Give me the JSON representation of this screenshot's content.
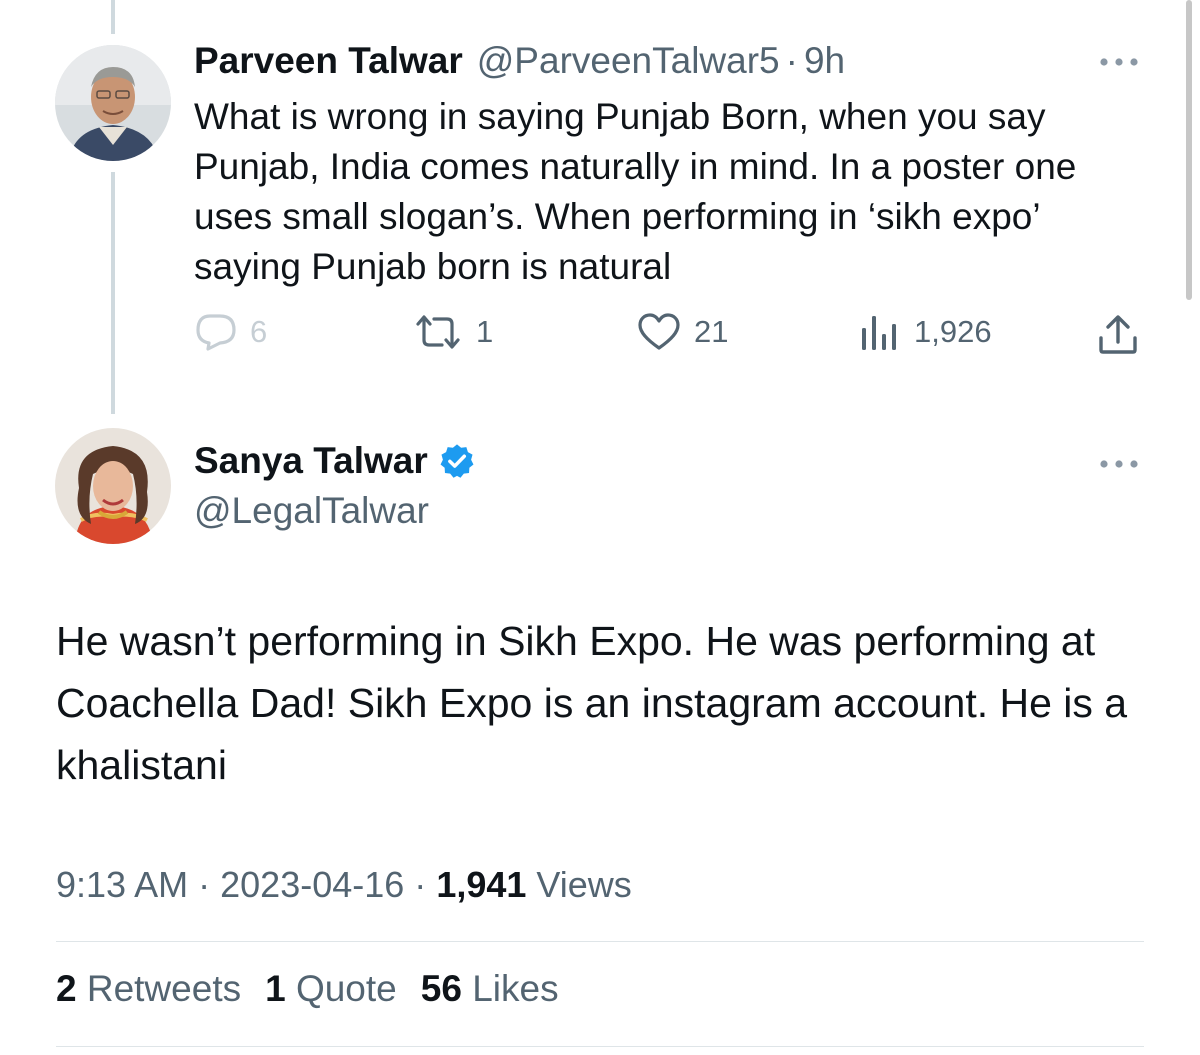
{
  "reply": {
    "author_name": "Parveen Talwar",
    "author_handle": "@ParveenTalwar5",
    "separator": "·",
    "time_ago": "9h",
    "more_icon": "more-horizontal-icon",
    "text": "What is wrong in saying Punjab Born, when you say Punjab, India comes naturally in mind. In a poster one uses small slogan’s. When performing in ‘sikh expo’ saying Punjab born is natural",
    "actions": {
      "replies": "6",
      "retweets": "1",
      "likes": "21",
      "views": "1,926"
    }
  },
  "main": {
    "author_name": "Sanya Talwar",
    "author_handle": "@LegalTalwar",
    "verified_color": "#1d9bf0",
    "more_icon": "more-horizontal-icon",
    "text": "He wasn’t performing in Sikh Expo. He was performing at Coachella Dad! Sikh Expo is an instagram account. He is a khalistani",
    "time": "9:13 AM",
    "separator": "·",
    "date": "2023-04-16",
    "views_count": "1,941",
    "views_label": "Views",
    "stats": {
      "retweets_count": "2",
      "retweets_label": "Retweets",
      "quotes_count": "1",
      "quotes_label": "Quote",
      "likes_count": "56",
      "likes_label": "Likes"
    }
  }
}
